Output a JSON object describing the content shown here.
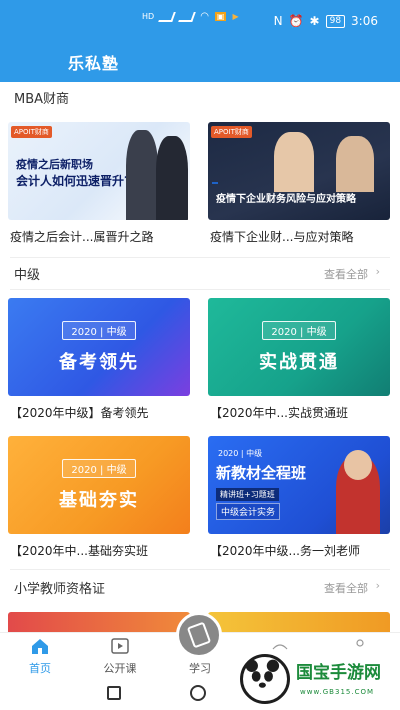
{
  "status_bar": {
    "network_labels": [
      "HD",
      "4G",
      "HD",
      "4G"
    ],
    "battery": "98",
    "time": "3:06"
  },
  "app_bar": {
    "title": "乐私塾"
  },
  "sections": {
    "mba": {
      "title": "MBA财商",
      "cards": [
        {
          "badge": "APOIT财商",
          "line1": "疫情之后新职场",
          "line2": "会计人如何迅速晋升?",
          "caption": "疫情之后会计...属晋升之路"
        },
        {
          "badge": "APOIT财商",
          "line1": "疫情下企业财务风险与应对策略",
          "caption": "疫情下企业财...与应对策略"
        }
      ]
    },
    "zhongji": {
      "title": "中级",
      "more": "查看全部",
      "more_arrow": "›",
      "cards": [
        {
          "year_tag": "2020 | 中级",
          "headline": "备考领先",
          "caption": "【2020年中级】备考领先"
        },
        {
          "year_tag": "2020 | 中级",
          "headline": "实战贯通",
          "caption": "【2020年中...实战贯通班"
        },
        {
          "year_tag": "2020 | 中级",
          "headline": "基础夯实",
          "caption": "【2020年中...基础夯实班"
        },
        {
          "year_tag": "2020 | 中级",
          "headline": "新教材全程班",
          "tag1": "精讲班+习题班",
          "tag2": "中级会计实务",
          "caption": "【2020年中级...务一刘老师"
        }
      ]
    },
    "teacher": {
      "title": "小学教师资格证",
      "more": "查看全部",
      "more_arrow": "›"
    }
  },
  "bottom_nav": {
    "items": [
      {
        "label": "首页",
        "icon": "home-icon",
        "active": true
      },
      {
        "label": "公开课",
        "icon": "video-icon",
        "active": false
      },
      {
        "label": "学习",
        "icon": "study-icon",
        "active": false
      },
      {
        "label": "",
        "icon": "message-icon",
        "active": false
      },
      {
        "label": "",
        "icon": "profile-icon",
        "active": false
      }
    ]
  },
  "watermark": {
    "title": "国宝手游网",
    "url": "www.GB315.COM"
  },
  "colors": {
    "primary": "#2f9ae8",
    "blue_tile": "#3b6ef0",
    "teal_tile": "#1aa892",
    "orange_tile": "#f79a24"
  }
}
